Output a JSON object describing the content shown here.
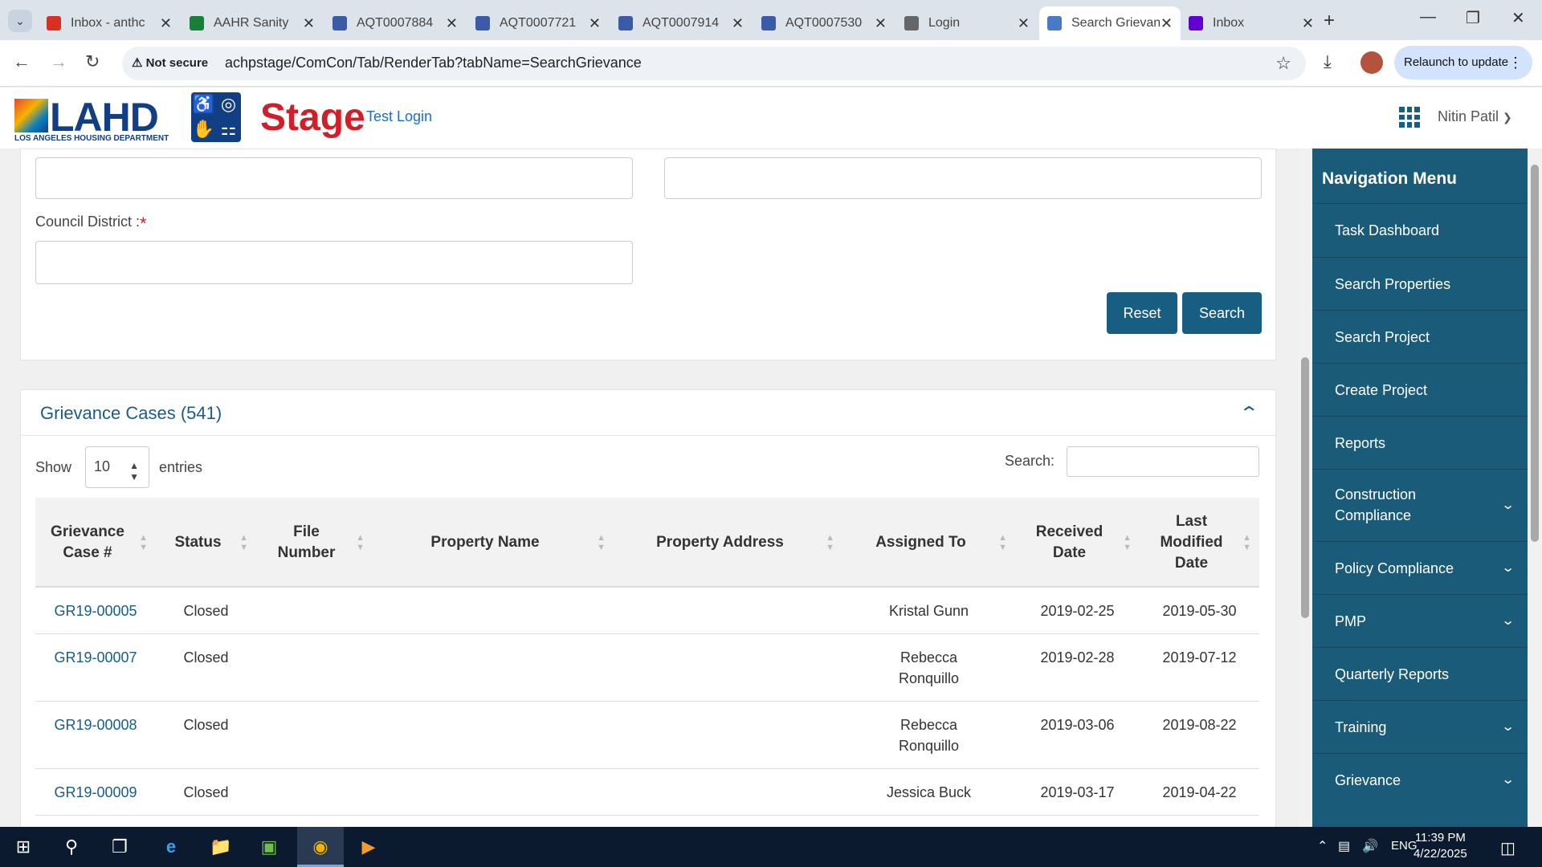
{
  "browser": {
    "tabs": [
      {
        "title": "Inbox - anthc",
        "favicon": "gmail-icon",
        "color": "#d93025"
      },
      {
        "title": "AAHR Sanity",
        "favicon": "sheets-icon",
        "color": "#188038"
      },
      {
        "title": "AQT0007884",
        "favicon": "lahd-icon",
        "color": "#3b5aa8"
      },
      {
        "title": "AQT0007721",
        "favicon": "lahd-icon",
        "color": "#3b5aa8"
      },
      {
        "title": "AQT0007914",
        "favicon": "lahd-icon",
        "color": "#3b5aa8"
      },
      {
        "title": "AQT0007530",
        "favicon": "lahd-icon",
        "color": "#3b5aa8"
      },
      {
        "title": "Login",
        "favicon": "globe-icon",
        "color": "#666666"
      },
      {
        "title": "Search Grievance",
        "favicon": "page-icon",
        "color": "#4a7ac7"
      },
      {
        "title": "Inbox",
        "favicon": "yahoo-icon",
        "color": "#5f01d1"
      }
    ],
    "active_tab": 7,
    "not_secure": "Not secure",
    "url": "achpstage/ComCon/Tab/RenderTab?tabName=SearchGrievance",
    "relaunch": "Relaunch to update"
  },
  "header": {
    "logo_text": "LAHD",
    "logo_sub": "LOS ANGELES HOUSING DEPARTMENT",
    "stage": "Stage",
    "test_login": "Test Login",
    "user": "Nitin Patil"
  },
  "search_form": {
    "council_district_label": "Council District :",
    "required_mark": "*",
    "reset": "Reset",
    "search": "Search"
  },
  "cases": {
    "title": "Grievance Cases (541)",
    "show": "Show",
    "page_length": "10",
    "entries": "entries",
    "search_label": "Search:",
    "columns": [
      "Grievance Case #",
      "Status",
      "File Number",
      "Property Name",
      "Property Address",
      "Assigned To",
      "Received Date",
      "Last Modified Date"
    ],
    "rows": [
      {
        "case": "GR19-00005",
        "status": "Closed",
        "file": "",
        "name": "",
        "address": "",
        "assigned": "Kristal Gunn",
        "received": "2019-02-25",
        "modified": "2019-05-30"
      },
      {
        "case": "GR19-00007",
        "status": "Closed",
        "file": "",
        "name": "",
        "address": "",
        "assigned": "Rebecca Ronquillo",
        "received": "2019-02-28",
        "modified": "2019-07-12"
      },
      {
        "case": "GR19-00008",
        "status": "Closed",
        "file": "",
        "name": "",
        "address": "",
        "assigned": "Rebecca Ronquillo",
        "received": "2019-03-06",
        "modified": "2019-08-22"
      },
      {
        "case": "GR19-00009",
        "status": "Closed",
        "file": "",
        "name": "",
        "address": "",
        "assigned": "Jessica Buck",
        "received": "2019-03-17",
        "modified": "2019-04-22"
      }
    ]
  },
  "nav": {
    "title": "Navigation Menu",
    "items": [
      {
        "label": "Task Dashboard",
        "expandable": false
      },
      {
        "label": "Search Properties",
        "expandable": false
      },
      {
        "label": "Search Project",
        "expandable": false
      },
      {
        "label": "Create Project",
        "expandable": false
      },
      {
        "label": "Reports",
        "expandable": false
      },
      {
        "label": "Construction Compliance",
        "expandable": true
      },
      {
        "label": "Policy Compliance",
        "expandable": true
      },
      {
        "label": "PMP",
        "expandable": true
      },
      {
        "label": "Quarterly Reports",
        "expandable": false
      },
      {
        "label": "Training",
        "expandable": true
      },
      {
        "label": "Grievance",
        "expandable": true
      }
    ]
  },
  "taskbar": {
    "time": "11:39 PM",
    "date": "4/22/2025",
    "lang": "ENG"
  },
  "colors": {
    "accent": "#185e83",
    "nav_bg": "#195b78",
    "stage_red": "#d11f2a"
  }
}
